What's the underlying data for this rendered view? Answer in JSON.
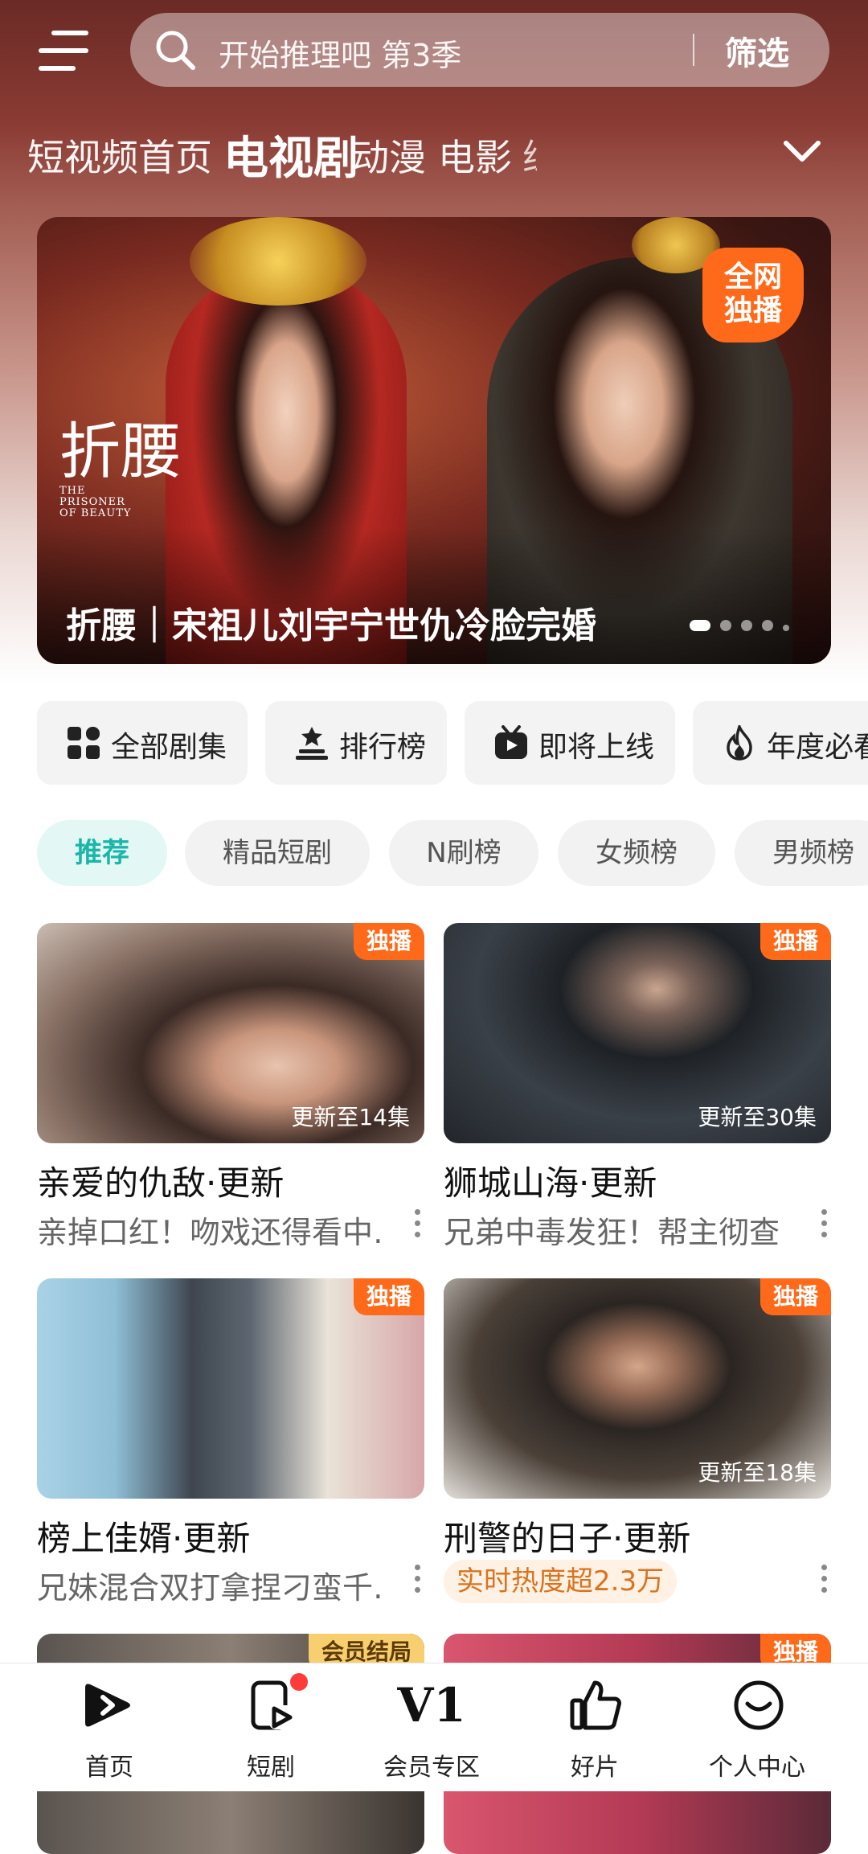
{
  "search": {
    "placeholder": "开始推理吧 第3季",
    "filter_label": "筛选"
  },
  "categories": [
    {
      "label": "短视频",
      "active": false
    },
    {
      "label": "首页",
      "active": false
    },
    {
      "label": "电视剧",
      "active": true
    },
    {
      "label": "动漫",
      "active": false
    },
    {
      "label": "电影",
      "active": false
    },
    {
      "label": "综",
      "active": false
    }
  ],
  "banner": {
    "caption": "折腰｜宋祖儿刘宇宁世仇冷脸完婚",
    "logo_cn": "折腰",
    "logo_en_1": "THE",
    "logo_en_2": "PRISONER",
    "logo_en_3": "OF BEAUTY",
    "badge_line1": "全网",
    "badge_line2": "独播",
    "slide_count": 5,
    "active_slide": 1
  },
  "quick_entries": [
    {
      "label": "全部剧集",
      "icon": "grid-icon"
    },
    {
      "label": "排行榜",
      "icon": "podium-icon"
    },
    {
      "label": "即将上线",
      "icon": "tv-play-icon"
    },
    {
      "label": "年度必看",
      "icon": "flame-icon"
    }
  ],
  "chips": [
    {
      "label": "推荐",
      "active": true
    },
    {
      "label": "精品短剧",
      "active": false
    },
    {
      "label": "N刷榜",
      "active": false
    },
    {
      "label": "女频榜",
      "active": false
    },
    {
      "label": "男频榜",
      "active": false
    }
  ],
  "cards": [
    {
      "title": "亲爱的仇敌·更新",
      "desc": "亲掉口红！吻戏还得看中…",
      "tag": "独播",
      "update": "更新至14集"
    },
    {
      "title": "狮城山海·更新",
      "desc": "兄弟中毒发狂！帮主彻查",
      "tag": "独播",
      "update": "更新至30集"
    },
    {
      "title": "榜上佳婿·更新",
      "desc": "兄妹混合双打拿捏刁蛮千…",
      "tag": "独播",
      "update": ""
    },
    {
      "title": "刑警的日子·更新",
      "hot": "实时热度超2.3万",
      "tag": "独播",
      "update": "更新至18集"
    },
    {
      "title": "",
      "desc": "",
      "tag": "会员结局",
      "update": ""
    },
    {
      "title": "",
      "desc": "",
      "tag": "独播",
      "update": ""
    }
  ],
  "bottom_nav": [
    {
      "label": "首页",
      "icon": "home-play-icon",
      "active": true
    },
    {
      "label": "短剧",
      "icon": "short-drama-icon",
      "badge_dot": true
    },
    {
      "label": "会员专区",
      "icon": "vip-v1-icon",
      "icon_text": "V1"
    },
    {
      "label": "好片",
      "icon": "thumbs-up-icon"
    },
    {
      "label": "个人中心",
      "icon": "smile-face-icon"
    }
  ],
  "colors": {
    "accent": "#1ab7a8",
    "tag_orange": "#ff6a1a",
    "vip_gold": "#f7cf6e",
    "hot_text": "#d9731f"
  }
}
